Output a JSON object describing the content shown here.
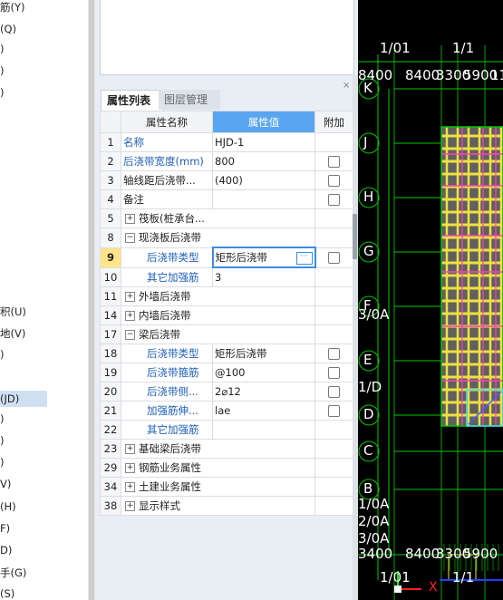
{
  "left_tree": [
    {
      "label": "筋(Y)",
      "sel": false
    },
    {
      "label": "(Q)",
      "sel": false
    },
    {
      "label": ")",
      "sel": false
    },
    {
      "label": ")",
      "sel": false
    },
    {
      "label": ")",
      "sel": false
    },
    {
      "label": "积(U)",
      "sel": false
    },
    {
      "label": "地(V)",
      "sel": false
    },
    {
      "label": ")",
      "sel": false
    },
    {
      "label": "(JD)",
      "sel": true
    },
    {
      "label": ")",
      "sel": false
    },
    {
      "label": ")",
      "sel": false
    },
    {
      "label": ")",
      "sel": false
    },
    {
      "label": "V)",
      "sel": false
    },
    {
      "label": "(H)",
      "sel": false
    },
    {
      "label": "F)",
      "sel": false
    },
    {
      "label": "D)",
      "sel": false
    },
    {
      "label": "手(G)",
      "sel": false
    },
    {
      "label": "(S)",
      "sel": false
    }
  ],
  "tabs": {
    "properties": "属性列表",
    "layers": "图层管理"
  },
  "columns": {
    "name": "属性名称",
    "value": "属性值",
    "extra": "附加"
  },
  "rows": [
    {
      "num": "1",
      "name": "名称",
      "value": "HJD-1",
      "blue": true,
      "cb": false,
      "exp": "",
      "ind": false
    },
    {
      "num": "2",
      "name": "后浇带宽度(mm)",
      "value": "800",
      "blue": true,
      "cb": true,
      "exp": "",
      "ind": false
    },
    {
      "num": "3",
      "name": "轴线距后浇带...",
      "value": "(400)",
      "blue": false,
      "cb": true,
      "exp": "",
      "ind": false
    },
    {
      "num": "4",
      "name": "备注",
      "value": "",
      "blue": false,
      "cb": true,
      "exp": "",
      "ind": false
    },
    {
      "num": "5",
      "name": "筏板(桩承台...",
      "value": "",
      "blue": false,
      "cb": false,
      "exp": "+",
      "ind": false
    },
    {
      "num": "8",
      "name": "现浇板后浇带",
      "value": "",
      "blue": false,
      "cb": false,
      "exp": "-",
      "ind": false
    },
    {
      "num": "9",
      "name": "后浇带类型",
      "value": "矩形后浇带",
      "blue": true,
      "cb": true,
      "exp": "",
      "ind": true,
      "cur": true
    },
    {
      "num": "10",
      "name": "其它加强筋",
      "value": "3",
      "blue": true,
      "cb": false,
      "exp": "",
      "ind": true
    },
    {
      "num": "11",
      "name": "外墙后浇带",
      "value": "",
      "blue": false,
      "cb": false,
      "exp": "+",
      "ind": false
    },
    {
      "num": "14",
      "name": "内墙后浇带",
      "value": "",
      "blue": false,
      "cb": false,
      "exp": "+",
      "ind": false
    },
    {
      "num": "17",
      "name": "梁后浇带",
      "value": "",
      "blue": false,
      "cb": false,
      "exp": "-",
      "ind": false
    },
    {
      "num": "18",
      "name": "后浇带类型",
      "value": "矩形后浇带",
      "blue": true,
      "cb": true,
      "exp": "",
      "ind": true
    },
    {
      "num": "19",
      "name": "后浇带箍筋",
      "value": "@100",
      "blue": true,
      "cb": true,
      "exp": "",
      "ind": true
    },
    {
      "num": "20",
      "name": "后浇带侧...",
      "value": "2⌀12",
      "blue": true,
      "cb": true,
      "exp": "",
      "ind": true
    },
    {
      "num": "21",
      "name": "加强筋伸...",
      "value": "lae",
      "blue": true,
      "cb": true,
      "exp": "",
      "ind": true
    },
    {
      "num": "22",
      "name": "其它加强筋",
      "value": "",
      "blue": true,
      "cb": false,
      "exp": "",
      "ind": true
    },
    {
      "num": "23",
      "name": "基础梁后浇带",
      "value": "",
      "blue": false,
      "cb": false,
      "exp": "+",
      "ind": false
    },
    {
      "num": "29",
      "name": "钢筋业务属性",
      "value": "",
      "blue": false,
      "cb": false,
      "exp": "+",
      "ind": false
    },
    {
      "num": "34",
      "name": "土建业务属性",
      "value": "",
      "blue": false,
      "cb": false,
      "exp": "+",
      "ind": false
    },
    {
      "num": "38",
      "name": "显示样式",
      "value": "",
      "blue": false,
      "cb": false,
      "exp": "+",
      "ind": false
    }
  ],
  "cad": {
    "top_labels": [
      "1/01",
      "1/1",
      "8400",
      "8400",
      "3300",
      "5900",
      "11"
    ],
    "axis_letters": [
      "K",
      "J",
      "H",
      "G",
      "F",
      "E",
      "D",
      "C",
      "B"
    ],
    "side_labels": [
      "3/0A",
      "1/D",
      "1/0A",
      "2/0A",
      "3/0A"
    ],
    "bottom_labels": [
      "3400",
      "8400",
      "3300",
      "5900",
      "1/01",
      "1/1"
    ],
    "axis_x_label": "X",
    "colors": {
      "grid": "#00c800",
      "wall": "#f0e040",
      "beam": "#ff40c0",
      "slab": "#606060",
      "cyan": "#40e0f0"
    }
  },
  "close_icon": "×"
}
